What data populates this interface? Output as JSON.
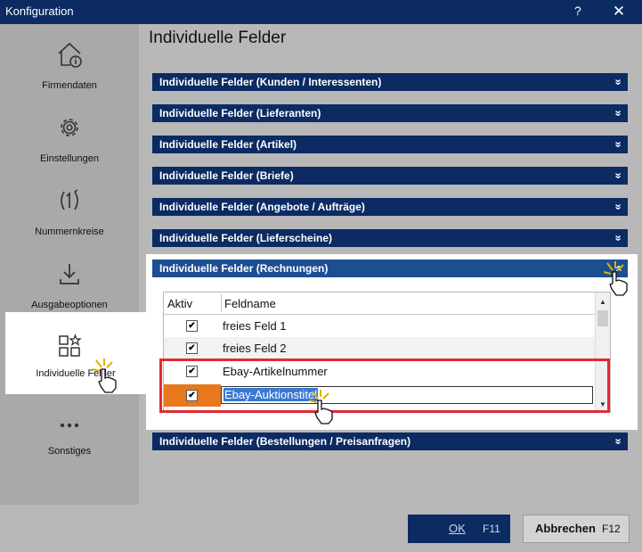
{
  "window": {
    "title": "Konfiguration",
    "help": "?",
    "close": "✕"
  },
  "sidebar": {
    "items": [
      {
        "label": "Firmendaten"
      },
      {
        "label": "Einstellungen"
      },
      {
        "label": "Nummernkreise"
      },
      {
        "label": "Ausgabeoptionen"
      },
      {
        "label": "Individuelle Felder"
      },
      {
        "label": "Sonstiges"
      }
    ]
  },
  "main": {
    "heading": "Individuelle Felder",
    "sections": [
      "Individuelle Felder (Kunden / Interessenten)",
      "Individuelle Felder (Lieferanten)",
      "Individuelle Felder (Artikel)",
      "Individuelle Felder (Briefe)",
      "Individuelle Felder (Angebote / Aufträge)",
      "Individuelle Felder (Lieferscheine)"
    ],
    "expanded": {
      "title": "Individuelle Felder (Rechnungen)",
      "columns": [
        "Aktiv",
        "Feldname"
      ],
      "rows": [
        {
          "aktiv": "✔",
          "feldname": "freies Feld 1"
        },
        {
          "aktiv": "✔",
          "feldname": "freies Feld 2"
        },
        {
          "aktiv": "✔",
          "feldname": "Ebay-Artikelnummer"
        },
        {
          "aktiv": "✔",
          "feldname": "Ebay-Auktionstitel"
        }
      ]
    },
    "last_section": "Individuelle Felder (Bestellungen / Preisanfragen)",
    "chevron": "»"
  },
  "footer": {
    "ok_label": "OK",
    "ok_shortcut": "F11",
    "cancel_label": "Abbrechen",
    "cancel_shortcut": "F12"
  },
  "colors": {
    "title_bar": "#0b2b62",
    "section_bar": "#0b2b62",
    "section_bar_open": "#1d4e92",
    "selected_row": "#e8781e",
    "highlight": "#e22a36"
  }
}
